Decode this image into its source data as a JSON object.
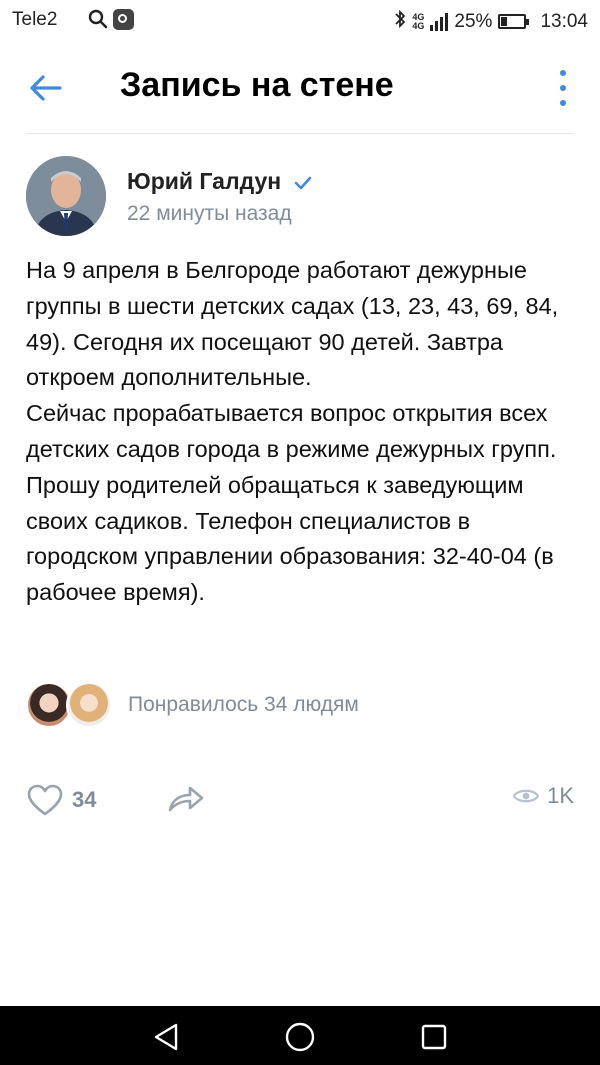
{
  "status_bar": {
    "carrier": "Tele2",
    "network": [
      "4G",
      "4G"
    ],
    "battery": "25%",
    "time": "13:04"
  },
  "header": {
    "title": "Запись на стене",
    "accent_color": "#3f8ae0"
  },
  "post": {
    "author": "Юрий Галдун",
    "time": "22 минуты назад",
    "paragraphs": [
      "На 9 апреля в Белгороде работают дежурные группы в шести детских садах (13, 23, 43, 69, 84, 49). Сегодня их посещают 90 детей. Завтра откроем дополнительные.",
      "Сейчас прорабатывается вопрос открытия всех детских садов города в режиме дежурных групп. Прошу родителей обращаться к заведующим своих садиков. Телефон специалистов в городском управлении образования: 32-40-04 (в рабочее время)."
    ],
    "likes_text": "Понравилось 34 людям",
    "like_count": "34",
    "views": "1K"
  },
  "icons": {
    "back": "arrow-left-icon",
    "more": "more-vertical-icon",
    "verified": "checkmark-icon",
    "like": "heart-icon",
    "share": "share-arrow-icon",
    "views": "eye-icon"
  }
}
